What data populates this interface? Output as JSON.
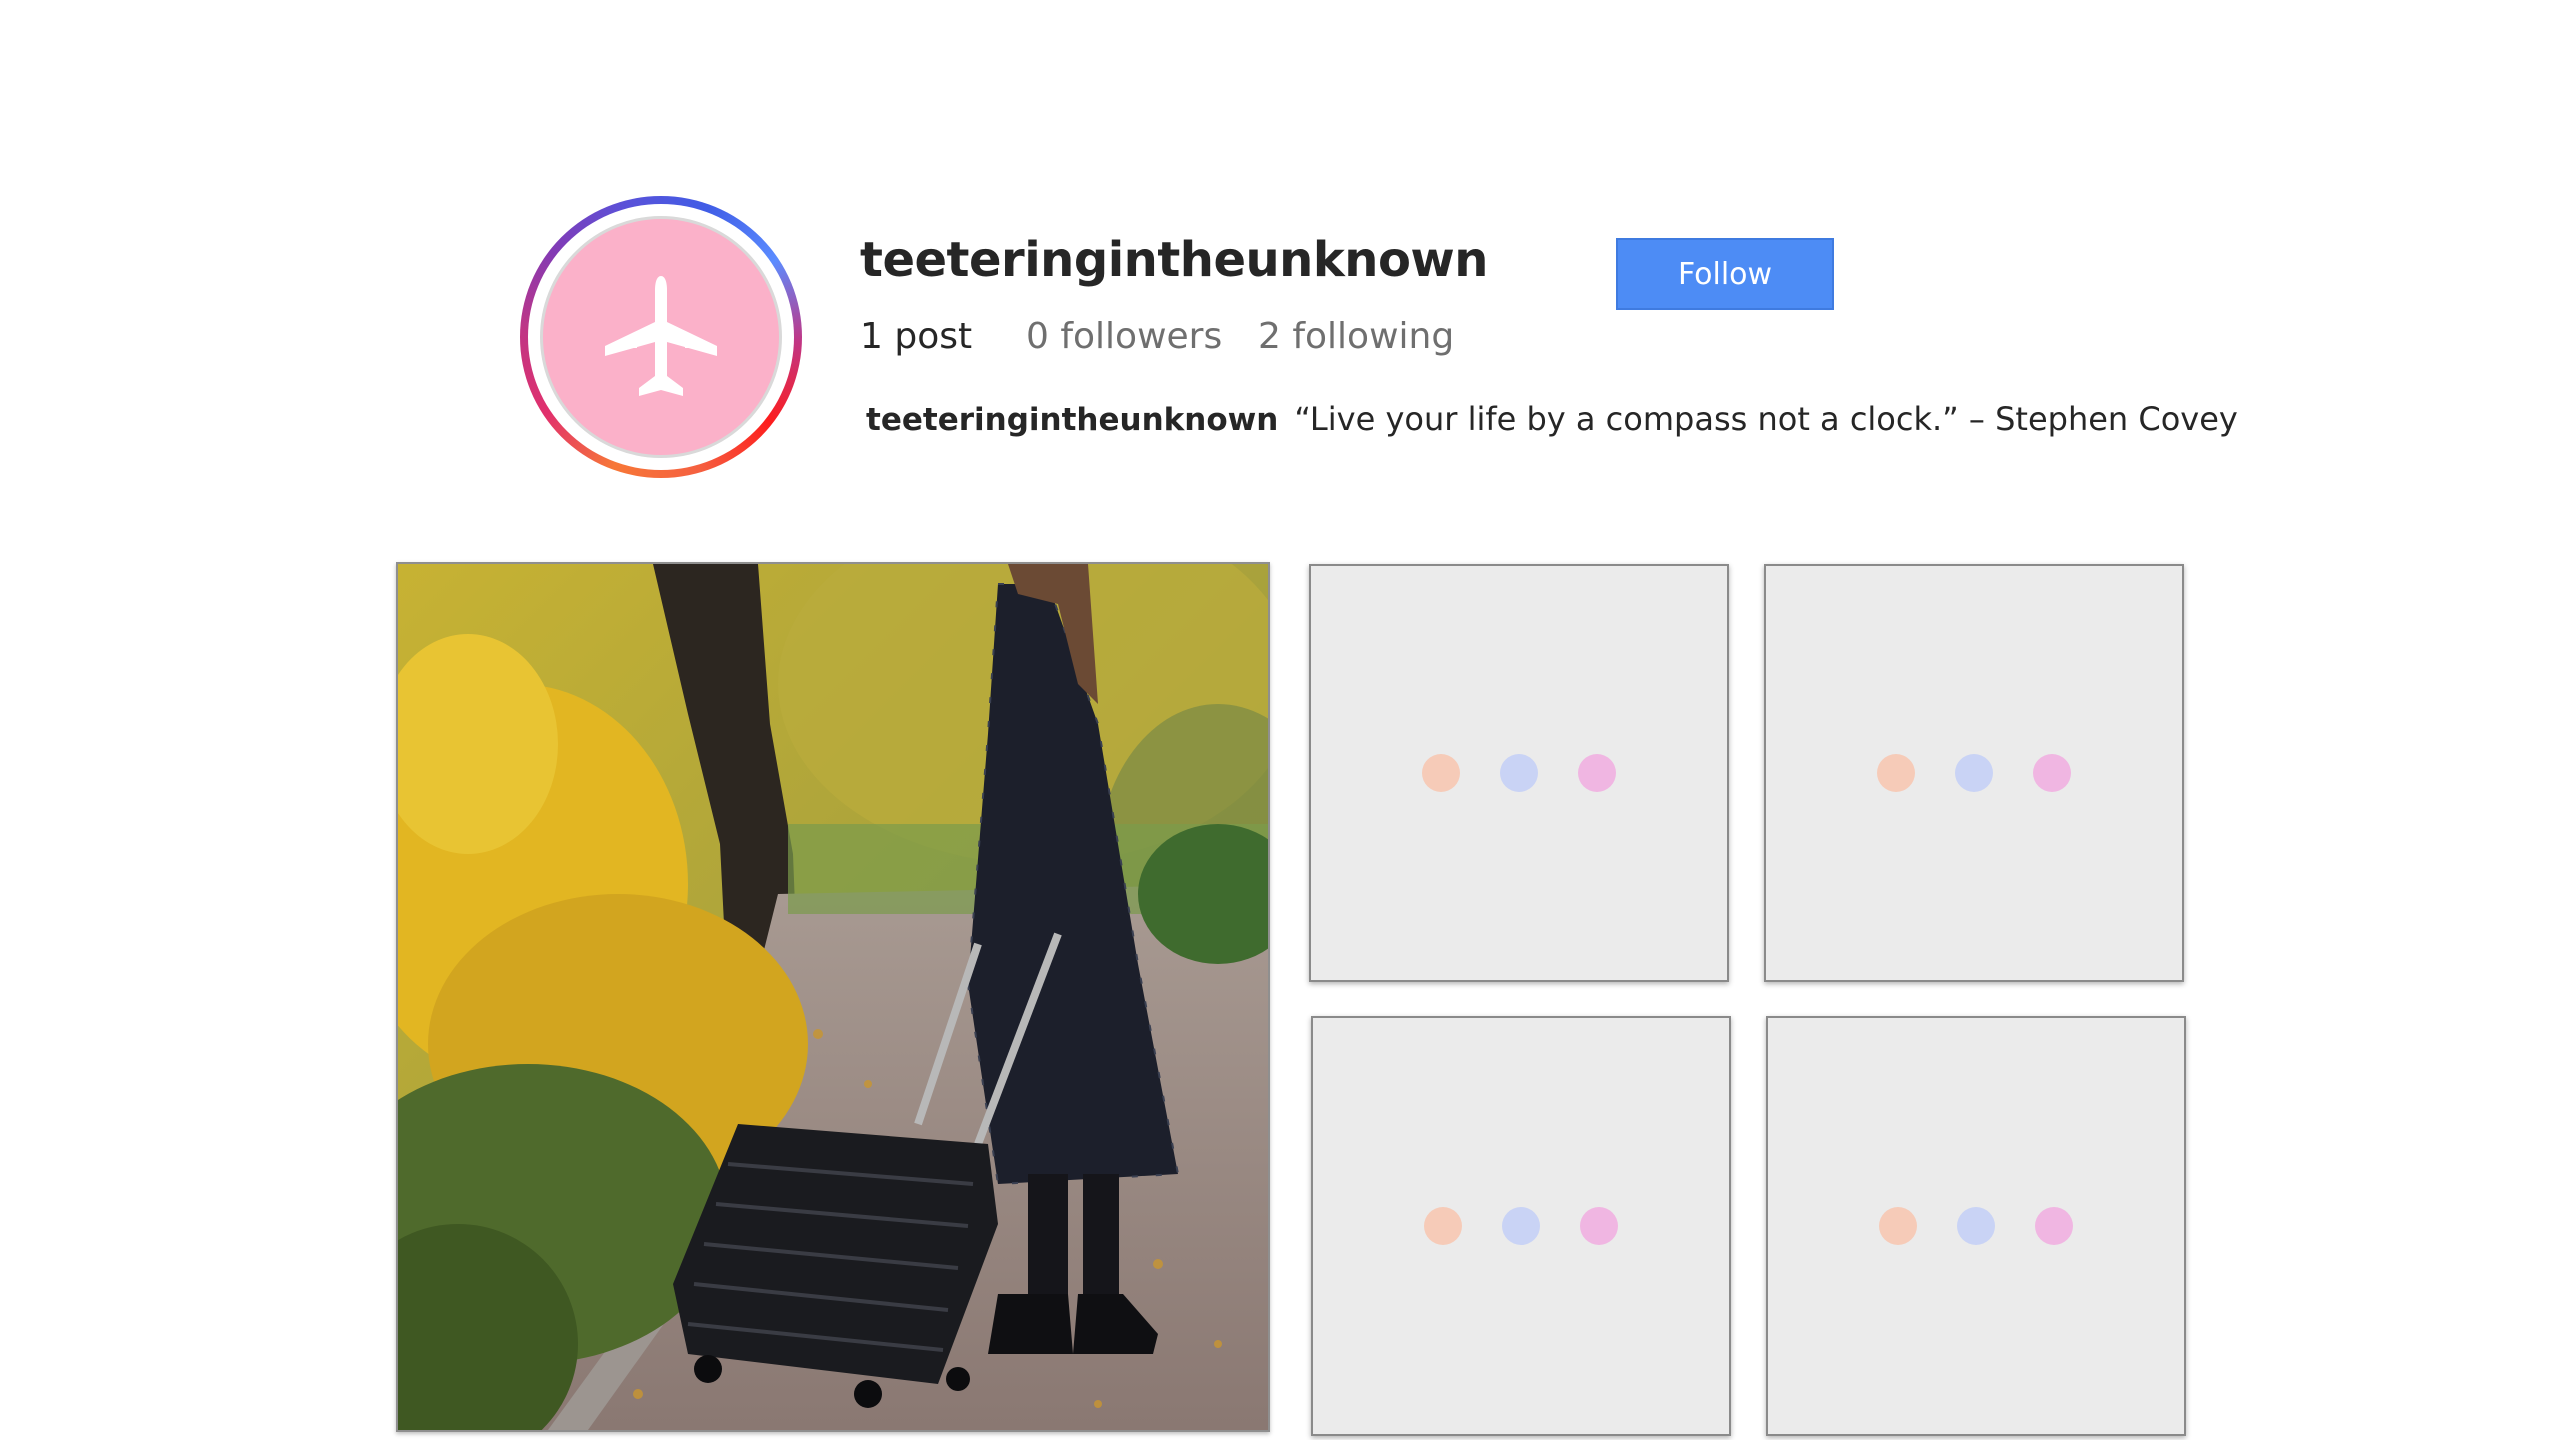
{
  "profile": {
    "username": "teeteringintheunknown",
    "follow_label": "Follow",
    "stats": {
      "posts": "1 post",
      "followers": "0 followers",
      "following": "2 following"
    },
    "bio": {
      "name": "teeteringintheunknown",
      "text": "“Live your life by a compass not a clock.” – Stephen Covey"
    },
    "avatar_icon": "airplane-icon",
    "colors": {
      "follow_button": "#4d8cf5",
      "avatar_fill": "#fbb1c9"
    }
  },
  "grid": {
    "posts": [
      {
        "kind": "photo",
        "subject": "traveler-with-suitcase-photo"
      }
    ],
    "placeholders": [
      {
        "dots": [
          "#f6cbb8",
          "#c9d3f5",
          "#f0b6e2"
        ]
      },
      {
        "dots": [
          "#f6cbb8",
          "#c9d3f5",
          "#f0b6e2"
        ]
      },
      {
        "dots": [
          "#f6cbb8",
          "#c9d3f5",
          "#f0b6e2"
        ]
      },
      {
        "dots": [
          "#f6cbb8",
          "#c9d3f5",
          "#f0b6e2"
        ]
      }
    ]
  }
}
